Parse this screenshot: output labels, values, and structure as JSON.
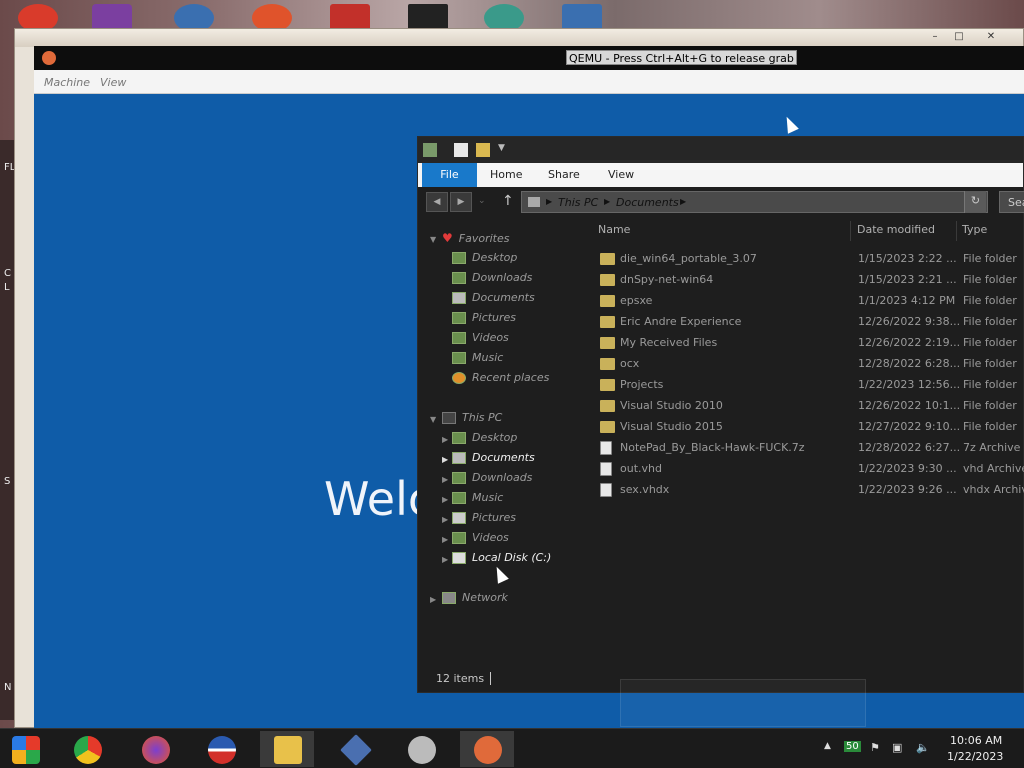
{
  "qemu": {
    "title": "QEMU - Press Ctrl+Alt+G to release grab",
    "menu": [
      "Machine",
      "View"
    ]
  },
  "guest": {
    "welcome_text": "Welc"
  },
  "explorer": {
    "ribbon_tabs": [
      "File",
      "Home",
      "Share",
      "View"
    ],
    "breadcrumb": [
      "This PC",
      "Documents"
    ],
    "search_placeholder": "Sea",
    "nav": {
      "favorites_label": "Favorites",
      "favorites": [
        "Desktop",
        "Downloads",
        "Documents",
        "Pictures",
        "Videos",
        "Music",
        "Recent places"
      ],
      "thispc_label": "This PC",
      "thispc": [
        "Desktop",
        "Documents",
        "Downloads",
        "Music",
        "Pictures",
        "Videos",
        "Local Disk (C:)"
      ],
      "network_label": "Network"
    },
    "columns": [
      "Name",
      "Date modified",
      "Type"
    ],
    "files": [
      {
        "name": "die_win64_portable_3.07",
        "date": "1/15/2023 2:22 ...",
        "type": "File folder",
        "icon": "folder-icon"
      },
      {
        "name": "dnSpy-net-win64",
        "date": "1/15/2023 2:21 ...",
        "type": "File folder",
        "icon": "folder-icon"
      },
      {
        "name": "epsxe",
        "date": "1/1/2023 4:12 PM",
        "type": "File folder",
        "icon": "folder-icon"
      },
      {
        "name": "Eric Andre Experience",
        "date": "12/26/2022 9:38...",
        "type": "File folder",
        "icon": "folder-icon"
      },
      {
        "name": "My Received Files",
        "date": "12/26/2022 2:19...",
        "type": "File folder",
        "icon": "folder-icon"
      },
      {
        "name": "ocx",
        "date": "12/28/2022 6:28...",
        "type": "File folder",
        "icon": "folder-icon"
      },
      {
        "name": "Projects",
        "date": "1/22/2023 12:56...",
        "type": "File folder",
        "icon": "folder-icon"
      },
      {
        "name": "Visual Studio 2010",
        "date": "12/26/2022 10:1...",
        "type": "File folder",
        "icon": "folder-icon"
      },
      {
        "name": "Visual Studio 2015",
        "date": "12/27/2022 9:10...",
        "type": "File folder",
        "icon": "folder-icon"
      },
      {
        "name": "NotePad_By_Black-Hawk-FUCK.7z",
        "date": "12/28/2022 6:27...",
        "type": "7z Archive",
        "icon": "archive-icon"
      },
      {
        "name": "out.vhd",
        "date": "1/22/2023 9:30 ...",
        "type": "vhd Archive",
        "icon": "disk-image-icon"
      },
      {
        "name": "sex.vhdx",
        "date": "1/22/2023 9:26 ...",
        "type": "vhdx Archive",
        "icon": "disk-image-icon"
      }
    ],
    "status_text": "12 items"
  },
  "taskbar": {
    "apps": [
      "chrome-icon",
      "firefox-icon",
      "obama-icon",
      "file-explorer-icon",
      "vs-icon",
      "skull-app-icon",
      "qemu-icon"
    ],
    "tray_badge": "50",
    "time": "10:06 AM",
    "date": "1/22/2023"
  },
  "left_strip_letters": [
    "FL",
    "C",
    "L",
    "S",
    "N"
  ],
  "colors": {
    "guest_bg": "#0f5ca8",
    "file_tab": "#1979ca",
    "explorer_bg": "#1e1e1e"
  }
}
